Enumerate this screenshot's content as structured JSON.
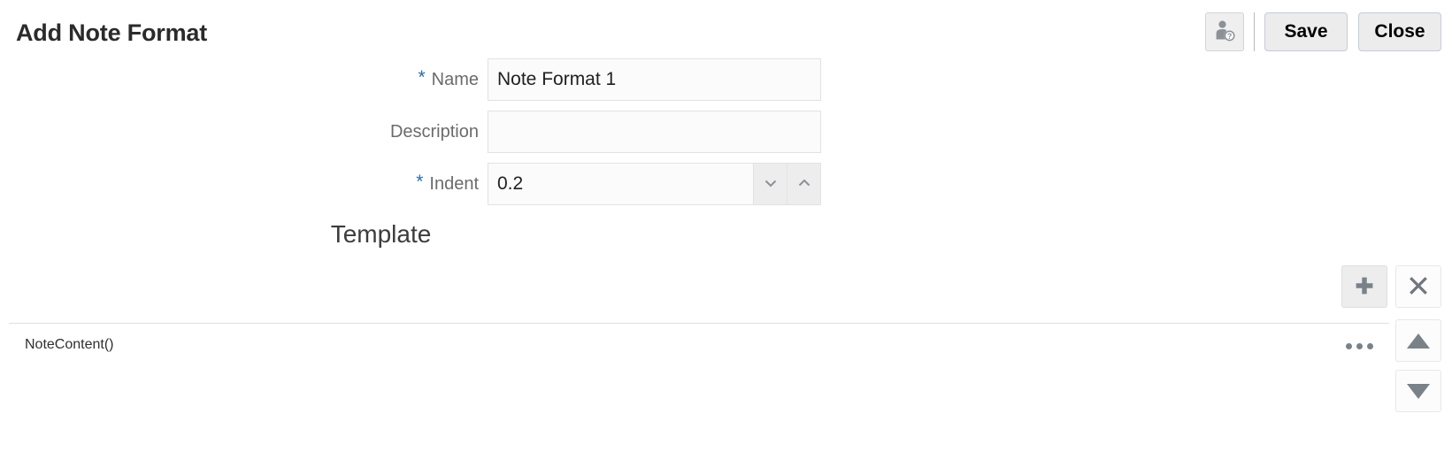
{
  "header": {
    "title": "Add Note Format",
    "help_icon": "user-help-icon",
    "save_label": "Save",
    "close_label": "Close"
  },
  "form": {
    "rows": [
      {
        "label": "Name",
        "required": true,
        "required_marker": "*",
        "value": "Note Format 1",
        "placeholder": "",
        "control": "text"
      },
      {
        "label": "Description",
        "required": false,
        "required_marker": "",
        "value": "",
        "placeholder": "",
        "control": "text"
      },
      {
        "label": "Indent",
        "required": true,
        "required_marker": "*",
        "value": "0.2",
        "placeholder": "",
        "control": "spinner",
        "decrement_icon": "chevron-down-icon",
        "increment_icon": "chevron-up-icon"
      }
    ]
  },
  "template": {
    "heading": "Template",
    "toolbar": {
      "add_icon": "plus-icon",
      "delete_icon": "close-x-icon"
    },
    "rows": [
      {
        "label": "NoteContent()",
        "more_icon": "ellipsis-icon"
      }
    ],
    "reorder": {
      "move_up_icon": "triangle-up-icon",
      "move_down_icon": "triangle-down-icon"
    }
  },
  "colors": {
    "required_marker": "#2a6ab0",
    "label_text": "#6b6b6b",
    "title_text": "#2b2b2b",
    "icon_gray": "#7a8289",
    "button_face": "#ececec",
    "separator": "#e0e0e0"
  }
}
